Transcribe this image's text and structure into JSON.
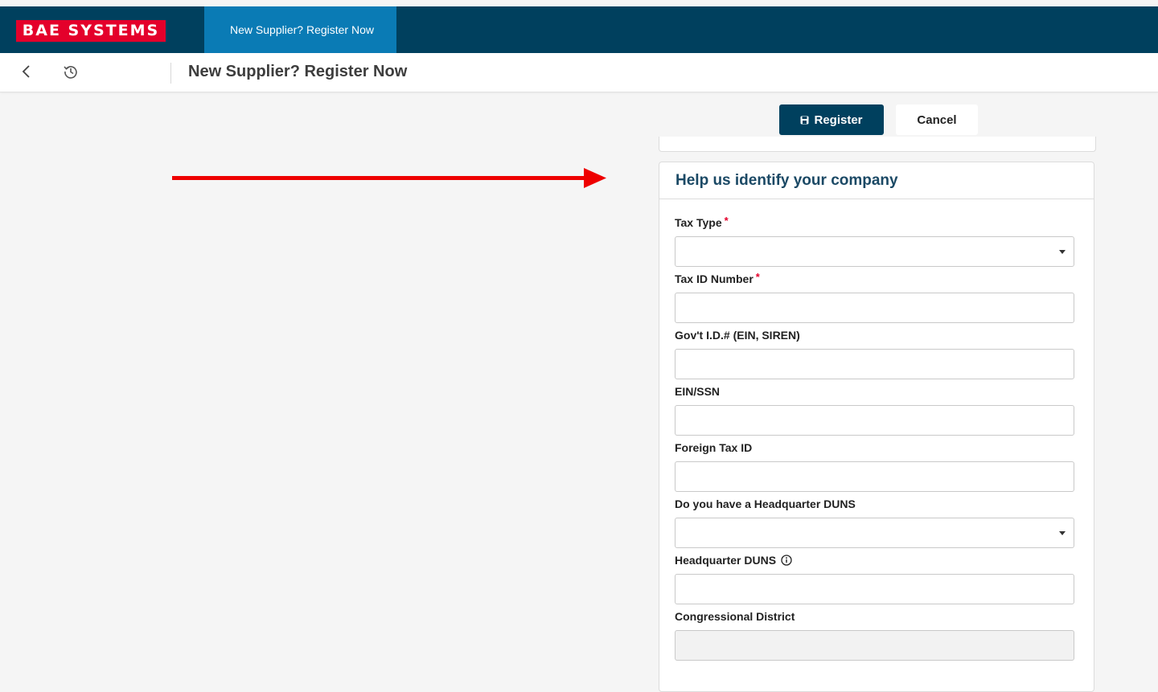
{
  "header": {
    "logo_text": "BAE SYSTEMS",
    "active_tab": "New Supplier? Register Now"
  },
  "subheader": {
    "title": "New Supplier? Register Now",
    "back_icon": "chevron-left-icon",
    "history_icon": "history-icon"
  },
  "actions": {
    "register_label": "Register",
    "cancel_label": "Cancel"
  },
  "panel": {
    "title": "Help us identify your company",
    "fields": [
      {
        "label": "Tax Type",
        "required": true,
        "type": "select",
        "value": ""
      },
      {
        "label": "Tax ID Number",
        "required": true,
        "type": "text",
        "value": ""
      },
      {
        "label": "Gov't I.D.# (EIN, SIREN)",
        "required": false,
        "type": "text",
        "value": ""
      },
      {
        "label": "EIN/SSN",
        "required": false,
        "type": "text",
        "value": ""
      },
      {
        "label": "Foreign Tax ID",
        "required": false,
        "type": "text",
        "value": ""
      },
      {
        "label": "Do you have a Headquarter DUNS",
        "required": false,
        "type": "select",
        "value": ""
      },
      {
        "label": "Headquarter DUNS",
        "required": false,
        "type": "text",
        "value": "",
        "info_icon": true
      },
      {
        "label": "Congressional District",
        "required": false,
        "type": "text",
        "value": "",
        "disabled": true
      }
    ]
  },
  "colors": {
    "brand_navy": "#00405e",
    "tab_blue": "#0a7bb5",
    "logo_red": "#e4002b",
    "annotation_arrow": "#ee0000"
  }
}
